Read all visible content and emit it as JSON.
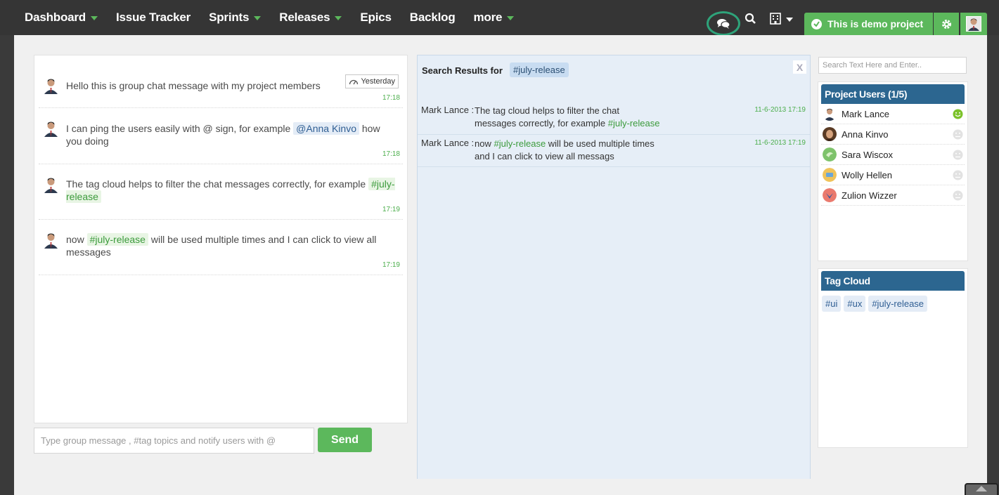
{
  "nav": {
    "items": [
      {
        "label": "Dashboard",
        "caret": true
      },
      {
        "label": "Issue Tracker",
        "caret": false
      },
      {
        "label": "Sprints",
        "caret": true
      },
      {
        "label": "Releases",
        "caret": true
      },
      {
        "label": "Epics",
        "caret": false
      },
      {
        "label": "Backlog",
        "caret": false
      },
      {
        "label": "more",
        "caret": true
      }
    ],
    "project_label": "This is demo project",
    "icons": [
      "chat-icon",
      "search-icon",
      "building-icon",
      "gear-icon",
      "user-avatar"
    ]
  },
  "chat": {
    "messages": [
      {
        "text": "Hello this is group chat message with my project members",
        "time": "17:18",
        "badge": "Yesterday"
      },
      {
        "pre": "I can ping the users easily with @ sign, for example ",
        "mention": "@Anna Kinvo",
        "post": " how you doing",
        "time": "17:18"
      },
      {
        "pre": "The tag cloud helps to filter the chat messages correctly, for example ",
        "tag": "#july-release",
        "time": "17:19"
      },
      {
        "pre": "now ",
        "tag": "#july-release",
        "post": " will be used multiple times and I can click to view all messages",
        "time": "17:19"
      }
    ],
    "input_placeholder": "Type group message , #tag topics and notify users with @",
    "send_label": "Send"
  },
  "search": {
    "title": "Search Results for",
    "tag": "#july-release",
    "close_label": "X",
    "results": [
      {
        "user": "Mark Lance :",
        "line1": "The tag cloud helps to filter the chat",
        "line2_pre": "messages correctly, for example ",
        "line2_tag": "#july-release",
        "time": "11-6-2013 17:19"
      },
      {
        "user": "Mark Lance :",
        "line1_pre": "now ",
        "line1_tag": "#july-release",
        "line1_post": " will be used multiple times",
        "line2": "and I can click to view all messags",
        "time": "11-6-2013 17:19"
      }
    ]
  },
  "sidebar": {
    "search_placeholder": "Search Text Here and Enter..",
    "users_title": "Project Users (1/5)",
    "users": [
      {
        "name": "Mark Lance",
        "online": true
      },
      {
        "name": "Anna Kinvo",
        "online": false
      },
      {
        "name": "Sara Wiscox",
        "online": false
      },
      {
        "name": "Wolly Hellen",
        "online": false
      },
      {
        "name": "Zulion Wizzer",
        "online": false
      }
    ],
    "tagcloud_title": "Tag Cloud",
    "tags": [
      "#ui",
      "#ux",
      "#july-release"
    ]
  },
  "colors": {
    "accent_green": "#5cb85c",
    "header_blue": "#2c6690",
    "nav_bg": "#353535"
  }
}
